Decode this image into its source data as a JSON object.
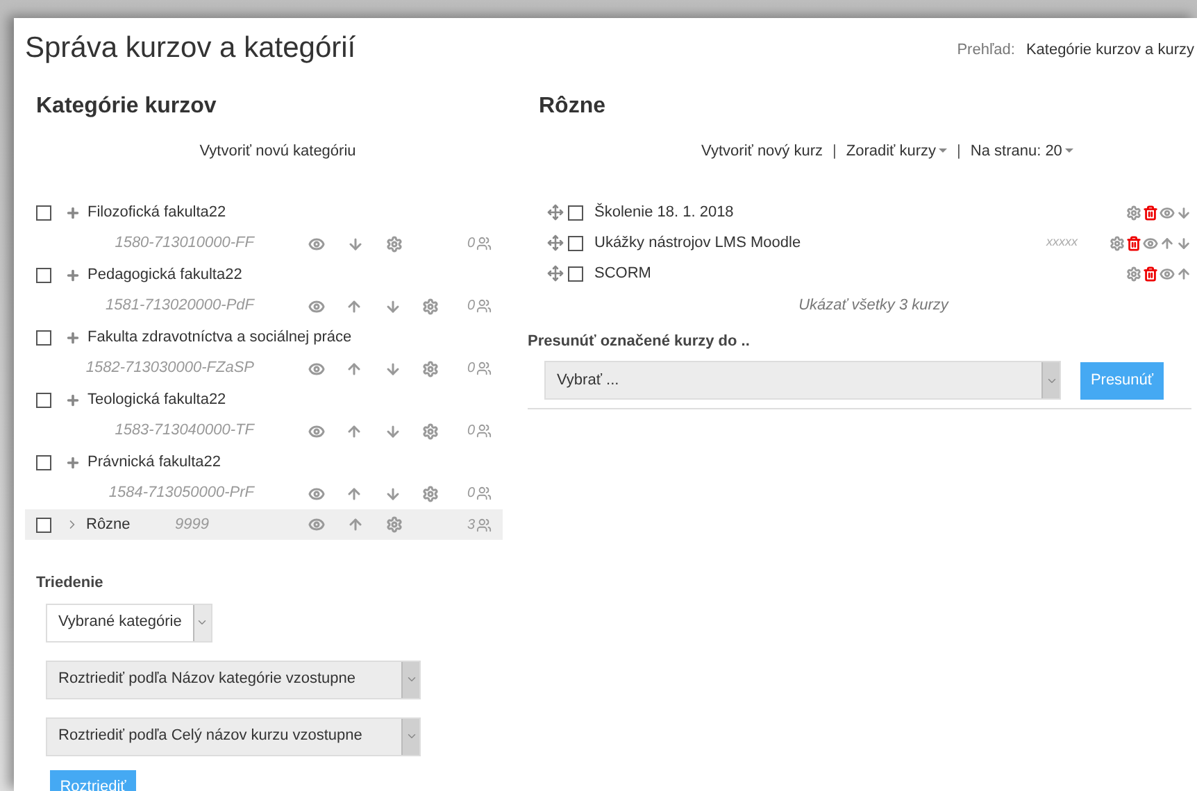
{
  "page_title": "Správa kurzov a kategórií",
  "view": {
    "label": "Prehľad:",
    "value": "Kategórie kurzov a kurzy"
  },
  "categories_panel": {
    "heading": "Kategórie kurzov",
    "create_link": "Vytvoriť novú kategóriu",
    "items": [
      {
        "name": "Filozofická fakulta22",
        "idnumber": "1580-713010000-FF",
        "kind": "expandable",
        "selected": false,
        "checked": false,
        "actions": [
          {
            "kind": "show"
          },
          {
            "kind": "down"
          },
          {
            "kind": "settings"
          }
        ],
        "count": "0"
      },
      {
        "name": "Pedagogická fakulta22",
        "idnumber": "1581-713020000-PdF",
        "kind": "expandable",
        "selected": false,
        "checked": false,
        "actions": [
          {
            "kind": "show"
          },
          {
            "kind": "up"
          },
          {
            "kind": "down"
          },
          {
            "kind": "settings"
          }
        ],
        "count": "0"
      },
      {
        "name": "Fakulta zdravotníctva a sociálnej práce",
        "idnumber": "1582-713030000-FZaSP",
        "kind": "expandable",
        "selected": false,
        "checked": false,
        "actions": [
          {
            "kind": "show"
          },
          {
            "kind": "up"
          },
          {
            "kind": "down"
          },
          {
            "kind": "settings"
          }
        ],
        "count": "0"
      },
      {
        "name": "Teologická fakulta22",
        "idnumber": "1583-713040000-TF",
        "kind": "expandable",
        "selected": false,
        "checked": false,
        "actions": [
          {
            "kind": "show"
          },
          {
            "kind": "up"
          },
          {
            "kind": "down"
          },
          {
            "kind": "settings"
          }
        ],
        "count": "0"
      },
      {
        "name": "Právnická fakulta22",
        "idnumber": "1584-713050000-PrF",
        "kind": "expandable",
        "selected": false,
        "checked": false,
        "actions": [
          {
            "kind": "show"
          },
          {
            "kind": "up"
          },
          {
            "kind": "down"
          },
          {
            "kind": "settings"
          }
        ],
        "count": "0"
      },
      {
        "name": "Rôzne",
        "idnumber": "9999",
        "kind": "collapsed",
        "selected": true,
        "checked": false,
        "actions": [
          {
            "kind": "show"
          },
          {
            "kind": "up"
          },
          {
            "kind": "settings"
          }
        ],
        "count": "3"
      }
    ],
    "sorting": {
      "label": "Triedenie",
      "scope": "Vybrané kategórie",
      "sort_categories": "Roztriediť podľa Názov kategórie vzostupne",
      "sort_courses": "Roztriediť podľa Celý názov kurzu vzostupne",
      "button": "Roztriediť"
    }
  },
  "courses_panel": {
    "heading": "Rôzne",
    "toolbar": [
      {
        "kind": "link",
        "text": "Vytvoriť nový kurz"
      },
      {
        "kind": "separator",
        "text": "|"
      },
      {
        "kind": "menu",
        "text": "Zoradiť kurzy"
      },
      {
        "kind": "separator",
        "text": "|"
      },
      {
        "kind": "menu",
        "text": "Na stranu: 20"
      }
    ],
    "items": [
      {
        "name": "Školenie 18. 1. 2018",
        "checked": false,
        "actions": [
          {
            "kind": "settings"
          },
          {
            "kind": "delete"
          },
          {
            "kind": "show"
          },
          {
            "kind": "down"
          }
        ]
      },
      {
        "name": "Ukážky nástrojov LMS Moodle",
        "idnumber": "xxxxx",
        "checked": false,
        "actions": [
          {
            "kind": "settings"
          },
          {
            "kind": "delete"
          },
          {
            "kind": "show"
          },
          {
            "kind": "up"
          },
          {
            "kind": "down"
          }
        ]
      },
      {
        "name": "SCORM",
        "checked": false,
        "actions": [
          {
            "kind": "settings"
          },
          {
            "kind": "delete"
          },
          {
            "kind": "show"
          },
          {
            "kind": "up"
          }
        ]
      }
    ],
    "show_all": "Ukázať všetky 3 kurzy",
    "move": {
      "label": "Presunúť označené kurzy do ..",
      "placeholder": "Vybrať ...",
      "button": "Presunúť"
    }
  }
}
